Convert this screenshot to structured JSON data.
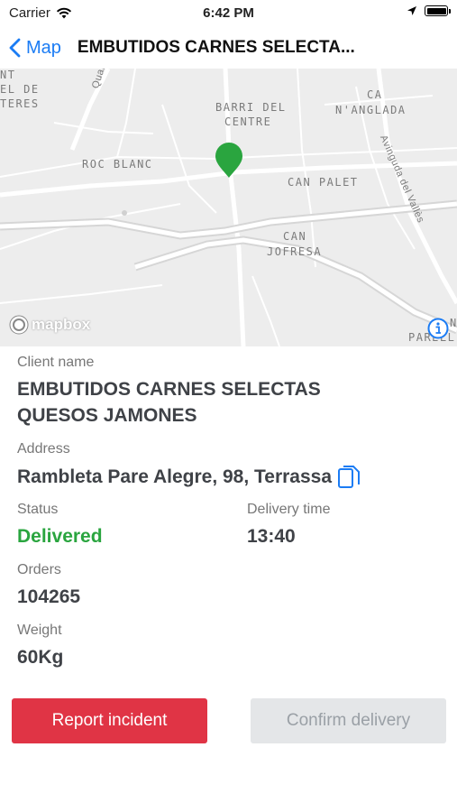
{
  "status_bar": {
    "carrier": "Carrier",
    "time": "6:42 PM"
  },
  "nav": {
    "back_label": "Map",
    "title": "EMBUTIDOS CARNES SELECTA..."
  },
  "map": {
    "labels": {
      "nt": "NT",
      "el_de": "EL DE",
      "teres": "TERES",
      "quart": "Quart Ce",
      "barri": "BARRI DEL",
      "centre": "CENTRE",
      "ca": "CA",
      "nanglada": "N'ANGLADA",
      "roc_blanc": "ROC BLANC",
      "can_palet": "CAN PALET",
      "can": "CAN",
      "jofresa": "JOFRESA",
      "avinguda": "Avinguda del Vallès",
      "parell": "PARELL",
      "n": "N"
    },
    "attribution": "mapbox",
    "pin_color": "#2aa53f"
  },
  "client": {
    "label": "Client name",
    "name_line1": "EMBUTIDOS CARNES SELECTAS",
    "name_line2": "QUESOS JAMONES"
  },
  "address": {
    "label": "Address",
    "value": "Rambleta Pare Alegre, 98, Terrassa"
  },
  "status": {
    "label": "Status",
    "value": "Delivered",
    "color": "#2aa53f"
  },
  "delivery_time": {
    "label": "Delivery time",
    "value": "13:40"
  },
  "orders": {
    "label": "Orders",
    "value": "104265"
  },
  "weight": {
    "label": "Weight",
    "value": "60Kg"
  },
  "actions": {
    "report_label": "Report incident",
    "confirm_label": "Confirm delivery"
  }
}
